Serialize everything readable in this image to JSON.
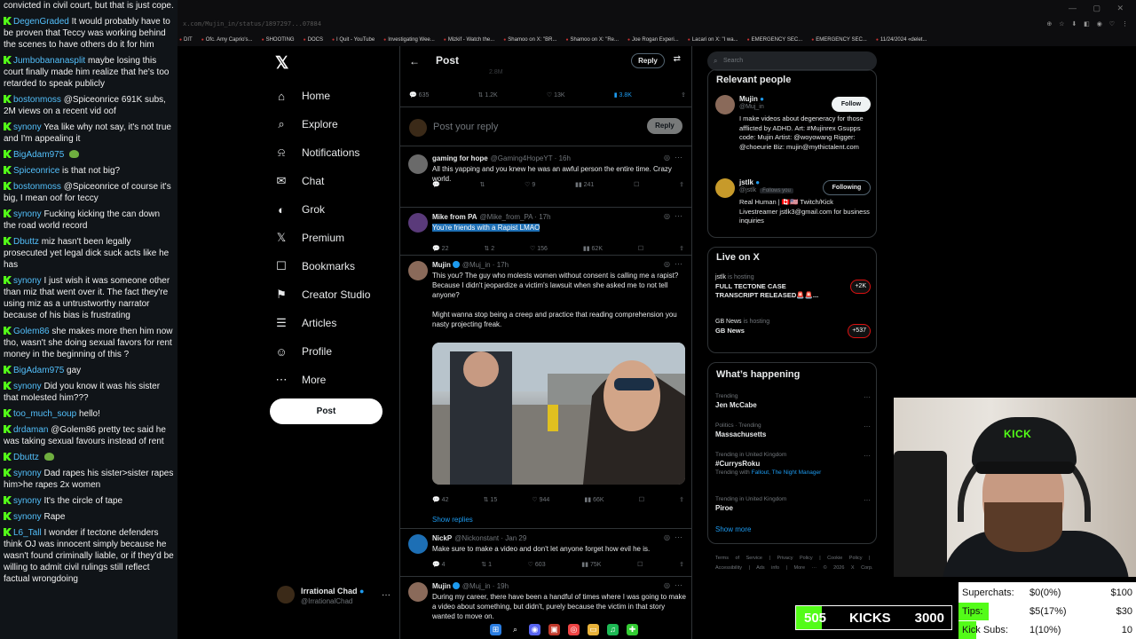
{
  "chat": [
    {
      "user": "",
      "text": "convicted in civil court, but that is just cope."
    },
    {
      "user": "DegenGraded",
      "text": "It would probably have to be proven that Teccy was working behind the scenes to have others do it for him"
    },
    {
      "user": "Jumbobananasplit",
      "text": "maybe losing this court finally made him realize that he's too retarded to speak publicly"
    },
    {
      "user": "bostonmoss",
      "text": "@Spiceonrice 691K subs, 2M views on a recent vid oof"
    },
    {
      "user": "synony",
      "text": "Yea like why not say, it's not true and I'm appealing it"
    },
    {
      "user": "BigAdam975",
      "text": "",
      "emote": true
    },
    {
      "user": "Spiceonrice",
      "text": "is that not big?"
    },
    {
      "user": "bostonmoss",
      "text": "@Spiceonrice of course it's big, I mean oof for teccy"
    },
    {
      "user": "synony",
      "text": "Fucking kicking the can down the road world record"
    },
    {
      "user": "Dbuttz",
      "text": "miz hasn't been legally prosecuted yet legal dick suck acts like he has"
    },
    {
      "user": "synony",
      "text": "I just wish it was someone other than miz that went over it. The fact they're using miz as a untrustworthy narrator because of his bias is frustrating"
    },
    {
      "user": "Golem86",
      "text": "she makes more then him now tho, wasn't she doing sexual favors for rent money in the beginning of this ?"
    },
    {
      "user": "BigAdam975",
      "text": "gay"
    },
    {
      "user": "synony",
      "text": "Did you know it was his sister that molested him???"
    },
    {
      "user": "too_much_soup",
      "text": "hello!"
    },
    {
      "user": "drdaman",
      "text": "@Golem86 pretty tec said he was taking sexual favours instead of rent"
    },
    {
      "user": "Dbuttz",
      "text": "",
      "emote": true
    },
    {
      "user": "synony",
      "text": "Dad rapes his sister>sister rapes him>he rapes 2x women"
    },
    {
      "user": "synony",
      "text": "It's the circle of tape"
    },
    {
      "user": "synony",
      "text": "Rape"
    },
    {
      "user": "L6_Tall",
      "text": "I wonder if tectone defenders think OJ was innocent simply because he wasn't found criminally liable, or if they'd be willing to admit civil rulings still reflect factual wrongdoing"
    }
  ],
  "browser": {
    "url": "x.com/Mujin_in/status/1897297...07884",
    "bookmarks": [
      "DIT",
      "Ofc. Amy Caprio's...",
      "SHOOTING",
      "DOCS",
      "I Quit - YouTube",
      "Investigating Wee...",
      "Mizkif - Watch the...",
      "Shamoo on X: \"BR...",
      "Shamoo on X: \"Re...",
      "Joe Rogan Experi...",
      "Lacari on X: \"I wa...",
      "EMERGENCY SEC...",
      "EMERGENCY SEC...",
      "11/24/2024 «delet..."
    ]
  },
  "nav": {
    "items": [
      {
        "icon": "home-icon",
        "glyph": "⌂",
        "label": "Home"
      },
      {
        "icon": "search-icon",
        "glyph": "⌕",
        "label": "Explore"
      },
      {
        "icon": "bell-icon",
        "glyph": "⍾",
        "label": "Notifications"
      },
      {
        "icon": "mail-icon",
        "glyph": "✉",
        "label": "Chat"
      },
      {
        "icon": "grok-icon",
        "glyph": "◐",
        "label": "Grok"
      },
      {
        "icon": "x-premium-icon",
        "glyph": "𝕏",
        "label": "Premium"
      },
      {
        "icon": "bookmark-icon",
        "glyph": "☐",
        "label": "Bookmarks"
      },
      {
        "icon": "creator-studio-icon",
        "glyph": "⚑",
        "label": "Creator Studio"
      },
      {
        "icon": "articles-icon",
        "glyph": "☰",
        "label": "Articles"
      },
      {
        "icon": "profile-icon",
        "glyph": "☺",
        "label": "Profile"
      },
      {
        "icon": "more-icon",
        "glyph": "⋯",
        "label": "More"
      }
    ],
    "post_label": "Post",
    "account_name": "Irrational Chad",
    "account_handle": "@IrrationalChad"
  },
  "post": {
    "title": "Post",
    "reply_btn": "Reply",
    "faded_stat": "2.8M",
    "stats": {
      "replies": "635",
      "reposts": "1.2K",
      "likes": "13K",
      "bookmarks": "3.8K"
    },
    "reply_placeholder": "Post your reply",
    "reply_submit": "Reply",
    "show_replies": "Show replies"
  },
  "tweets": [
    {
      "name": "gaming for hope",
      "handle": "@Gaming4HopeYT · 16h",
      "text": "All this yapping and you knew he was an awful person the entire time. Crazy world.",
      "stats": [
        "",
        "",
        "9",
        "241"
      ],
      "avatar": "#6a6a6a"
    },
    {
      "name": "Mike from PA",
      "handle": "@Mike_from_PA · 17h",
      "text": "You're friends with a Rapist LMAO",
      "stats": [
        "22",
        "2",
        "156",
        "62K"
      ],
      "avatar": "#5a3a7a",
      "highlight": true
    },
    {
      "name": "Mujin",
      "handle": "@Muj_in · 17h",
      "text": "This you? The guy who molests women without consent is calling me a rapist?\nBecause I didn't jeopardize a victim's lawsuit when she asked me to not tell anyone?\n\nMight wanna stop being a creep and practice that reading comprehension you nasty projecting freak.",
      "stats": [
        "42",
        "15",
        "944",
        "66K"
      ],
      "avatar": "#8a6a5a",
      "media": true
    },
    {
      "name": "NickP",
      "handle": "@Nickonstant · Jan 29",
      "text": "Make sure to make a video and don't let anyone forget how evil he is.",
      "stats": [
        "4",
        "1",
        "603",
        "75K"
      ],
      "avatar": "#1d6fb5"
    },
    {
      "name": "Mujin",
      "handle": "@Muj_in · 19h",
      "text": "During my career, there have been a handful of times where I was going to make a video about something, but didn't, purely because the victim in that story wanted to move on.",
      "stats": [
        "",
        "",
        "",
        ""
      ],
      "avatar": "#8a6a5a"
    }
  ],
  "right": {
    "search_placeholder": "Search",
    "relevant_title": "Relevant people",
    "people": [
      {
        "name": "Mujin",
        "handle": "@Muj_in",
        "button": "Follow",
        "bio": "I make videos about degeneracy for those afflicted by ADHD. Art: #Mujinrex Gsupps code: Mujin Artist: @woyowang Rigger: @choeurie Biz: mujin@mythictalent.com",
        "avatar": "#8a6a5a"
      },
      {
        "name": "jstlk",
        "handle": "@jstlk",
        "follows_you": "Follows you",
        "button": "Following",
        "bio": "Real Human | 🇨🇦🇺🇸 Twitch/Kick Livestreamer jstlk3@gmail.com for business inquiries",
        "avatar": "#c79a2a"
      }
    ],
    "live_title": "Live on X",
    "live": [
      {
        "who": "jstlk",
        "status": "is hosting",
        "title": "FULL TECTONE CASE TRANSCRIPT RELEASED🚨🚨...",
        "count": "+2K"
      },
      {
        "who": "GB News",
        "status": "is hosting",
        "title": "GB News",
        "count": "+537"
      }
    ],
    "happening_title": "What’s happening",
    "trends": [
      {
        "context": "Trending",
        "topic": "Jen McCabe",
        "sub": ""
      },
      {
        "context": "Politics · Trending",
        "topic": "Massachusetts",
        "sub": ""
      },
      {
        "context": "Trending in United Kingdom",
        "topic": "#CurrysRoku",
        "sub_prefix": "Trending with",
        "sub": "Fallout, The Night Manager"
      },
      {
        "context": "Trending in United Kingdom",
        "topic": "Piroe",
        "sub": ""
      }
    ],
    "show_more": "Show more",
    "footer": "Terms of Service | Privacy Policy | Cookie Policy | Accessibility | Ads info | More ··· © 2026 X Corp."
  },
  "stream": {
    "kicks_count": "505",
    "kicks_label": "KICKS",
    "kicks_goal": "3000",
    "kicks_progress": 0.168,
    "rows": [
      {
        "key": "Superchats:",
        "value": "$0(0%)",
        "goal": "$100",
        "progress": 0.0
      },
      {
        "key": "Tips:",
        "value": "$5(17%)",
        "goal": "$30",
        "progress": 0.17
      },
      {
        "key": "Kick Subs:",
        "value": "1(10%)",
        "goal": "10",
        "progress": 0.1
      }
    ],
    "cam_text": "KICK"
  }
}
